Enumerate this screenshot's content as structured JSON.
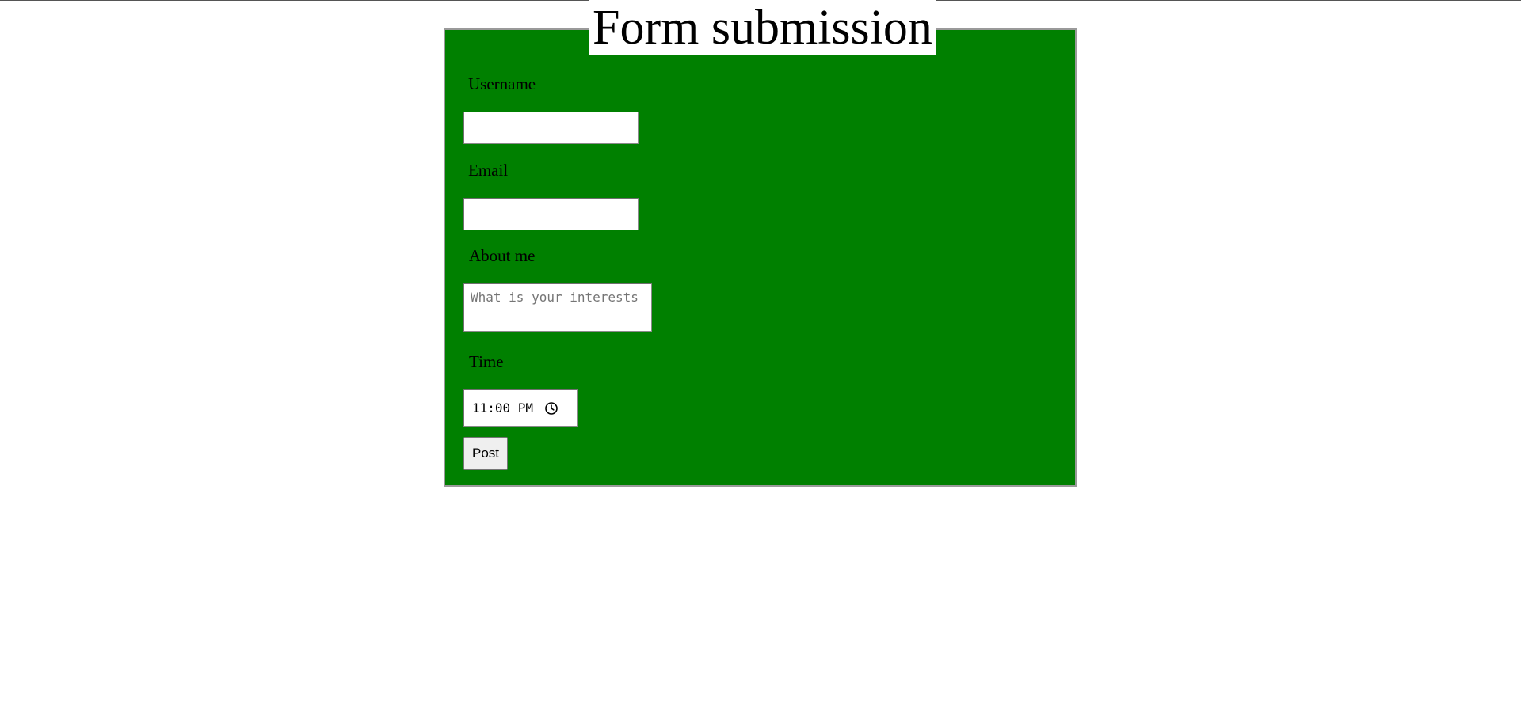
{
  "form": {
    "legend": "Form submission",
    "username": {
      "label": "Username",
      "value": ""
    },
    "email": {
      "label": "Email",
      "value": ""
    },
    "about": {
      "label": "About me",
      "placeholder": "What is your interests",
      "value": ""
    },
    "time": {
      "label": "Time",
      "value": "11:00 PM"
    },
    "submit_label": "Post"
  },
  "colors": {
    "fieldset_background": "#008000",
    "page_background": "#ffffff"
  },
  "icons": {
    "time_picker": "clock-icon"
  }
}
